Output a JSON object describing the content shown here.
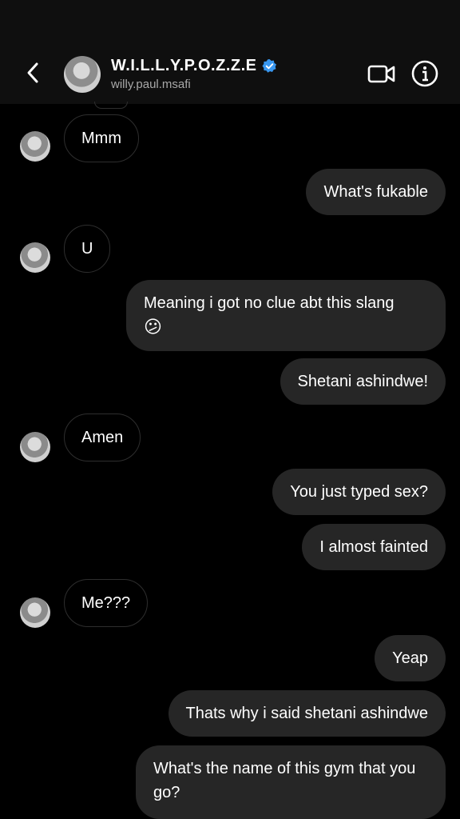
{
  "header": {
    "title": "W.I.L.L.Y.P.O.Z.Z.E",
    "subtitle": "willy.paul.msafi",
    "verified_color": "#3897f0"
  },
  "messages": [
    {
      "side": "in",
      "text": "Mmm"
    },
    {
      "side": "out",
      "text": "What's fukable"
    },
    {
      "side": "in",
      "text": "U"
    },
    {
      "side": "out",
      "text": "Meaning i got no clue abt this slang",
      "emoji": "😕"
    },
    {
      "side": "out",
      "text": "Shetani ashindwe!"
    },
    {
      "side": "in",
      "text": "Amen"
    },
    {
      "side": "out",
      "text": "You just typed sex?"
    },
    {
      "side": "out",
      "text": "I almost fainted"
    },
    {
      "side": "in",
      "text": "Me???"
    },
    {
      "side": "out",
      "text": "Yeap"
    },
    {
      "side": "out",
      "text": "Thats why i said shetani ashindwe"
    },
    {
      "side": "out",
      "text": "What's the name of this gym  that you go?"
    }
  ],
  "colors": {
    "background": "#000000",
    "header": "#0f0f0f",
    "outgoing_bubble": "#262626",
    "incoming_border": "#2e2e2e"
  }
}
